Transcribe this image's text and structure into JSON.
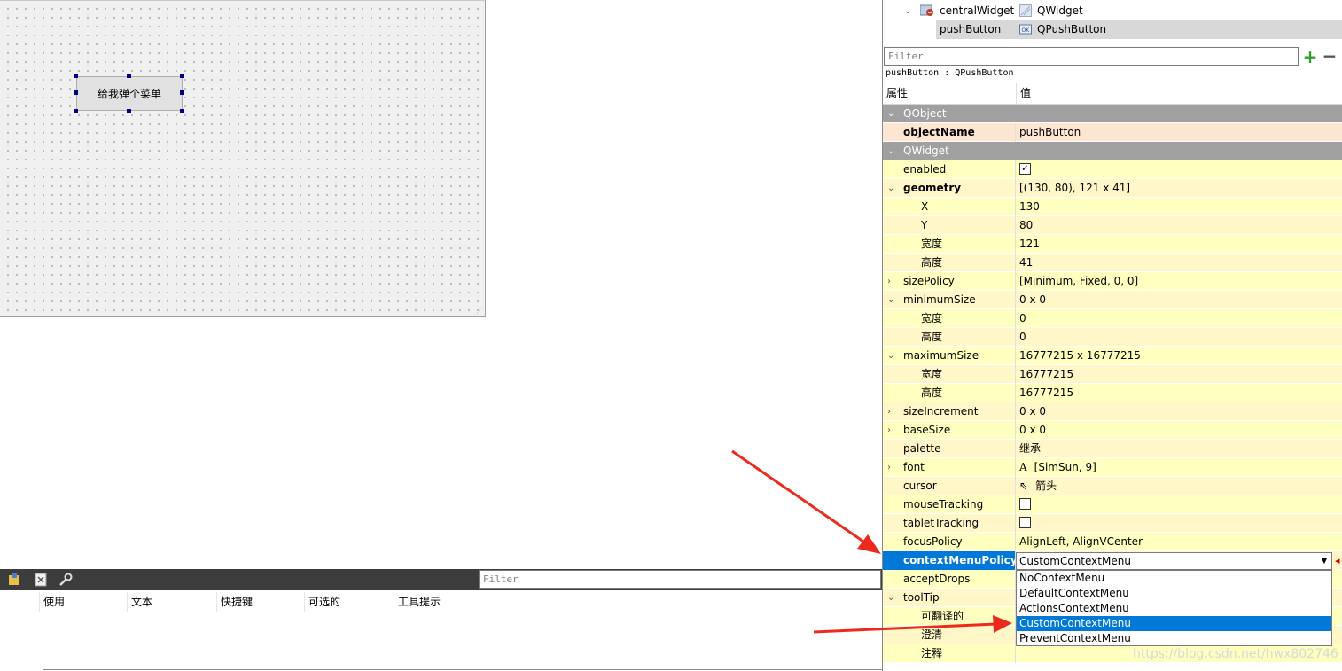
{
  "design": {
    "button_text": "给我弹个菜单"
  },
  "object_tree": {
    "rows": [
      {
        "name": "centralWidget",
        "class": "QWidget"
      },
      {
        "name": "pushButton",
        "class": "QPushButton"
      }
    ]
  },
  "property_editor": {
    "filter_placeholder": "Filter",
    "object_label": "pushButton : QPushButton",
    "header": {
      "property": "属性",
      "value": "值"
    },
    "rows": [
      {
        "name": "QObject",
        "value": ""
      },
      {
        "name": "objectName",
        "value": "pushButton"
      },
      {
        "name": "QWidget",
        "value": ""
      },
      {
        "name": "enabled",
        "value": ""
      },
      {
        "name": "geometry",
        "value": "[(130, 80), 121 x 41]"
      },
      {
        "name": "X",
        "value": "130"
      },
      {
        "name": "Y",
        "value": "80"
      },
      {
        "name": "宽度",
        "value": "121"
      },
      {
        "name": "高度",
        "value": "41"
      },
      {
        "name": "sizePolicy",
        "value": "[Minimum, Fixed, 0, 0]"
      },
      {
        "name": "minimumSize",
        "value": "0 x 0"
      },
      {
        "name": "宽度",
        "value": "0"
      },
      {
        "name": "高度",
        "value": "0"
      },
      {
        "name": "maximumSize",
        "value": "16777215 x 16777215"
      },
      {
        "name": "宽度",
        "value": "16777215"
      },
      {
        "name": "高度",
        "value": "16777215"
      },
      {
        "name": "sizeIncrement",
        "value": "0 x 0"
      },
      {
        "name": "baseSize",
        "value": "0 x 0"
      },
      {
        "name": "palette",
        "value": "继承"
      },
      {
        "name": "font",
        "value": "[SimSun, 9]"
      },
      {
        "name": "cursor",
        "value": "箭头"
      },
      {
        "name": "mouseTracking",
        "value": ""
      },
      {
        "name": "tabletTracking",
        "value": ""
      },
      {
        "name": "focusPolicy",
        "value": "AlignLeft, AlignVCenter"
      },
      {
        "name": "contextMenuPolicy",
        "value": ""
      },
      {
        "name": "acceptDrops",
        "value": ""
      },
      {
        "name": "toolTip",
        "value": ""
      },
      {
        "name": "可翻译的",
        "value": ""
      },
      {
        "name": "澄清",
        "value": ""
      },
      {
        "name": "注释",
        "value": ""
      }
    ],
    "context_menu_combo": {
      "selected": "CustomContextMenu",
      "options": [
        "NoContextMenu",
        "DefaultContextMenu",
        "ActionsContextMenu",
        "CustomContextMenu",
        "PreventContextMenu"
      ]
    }
  },
  "action_editor": {
    "filter_placeholder": "Filter",
    "columns": [
      "使用",
      "文本",
      "快捷键",
      "可选的",
      "工具提示"
    ]
  },
  "watermark": "https://blog.csdn.net/hwx802746",
  "colors": {
    "selection": "#0078d7",
    "property_bg": "#ffffbf",
    "section_bg": "#a0a0a0",
    "arrow": "#ee2a1f"
  }
}
